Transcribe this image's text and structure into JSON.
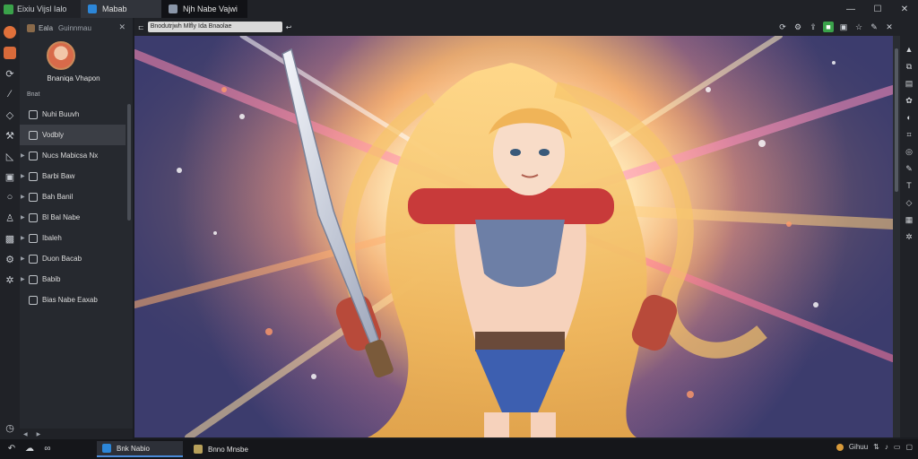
{
  "titlebar": {
    "app_name": "Eixiu Vijsl Ialo",
    "tabs": [
      {
        "label": "Mabab",
        "active": true
      },
      {
        "label": "Njh Nabe Vajwi",
        "active": false
      }
    ],
    "minimize_glyph": "—",
    "maximize_glyph": "☐",
    "close_glyph": "✕"
  },
  "sidebar": {
    "header_label": "Eala",
    "header_dropdown": "Guinnmau",
    "close_glyph": "✕",
    "username": "Bnaniqa Vhapon",
    "section_label": "Bnat",
    "items": [
      {
        "label": "Nuhi Buuvh",
        "active": false
      },
      {
        "label": "Vodbly",
        "active": true
      },
      {
        "label": "Nucs Mabicsa Nx",
        "active": false
      },
      {
        "label": "Barbi Baw",
        "active": false
      },
      {
        "label": "Bah Banil",
        "active": false
      },
      {
        "label": "Bl Bal Nabe",
        "active": false
      },
      {
        "label": "Ibaleh",
        "active": false
      },
      {
        "label": "Duon Bacab",
        "active": false
      },
      {
        "label": "Babib",
        "active": false
      },
      {
        "label": "Bias Nabe Eaxab",
        "active": false
      }
    ]
  },
  "toolbar": {
    "address": "Bnodutrjwh Mlfly Ida Bnaolae",
    "right_icons": [
      "refresh-icon",
      "settings-icon",
      "share-icon",
      "status-icon",
      "photo-icon",
      "star-icon",
      "edit-icon",
      "close-icon"
    ]
  },
  "taskbar": {
    "apps": [
      {
        "label": "Bnk Nabio",
        "active": true,
        "color": "#2c86d8"
      },
      {
        "label": "Bnno Mnsbe",
        "active": false,
        "color": "#b8a05a"
      }
    ],
    "tray_label": "Gihuu"
  },
  "colors": {
    "accent": "#4a8ad8",
    "green_icon": "#3aa24a"
  }
}
